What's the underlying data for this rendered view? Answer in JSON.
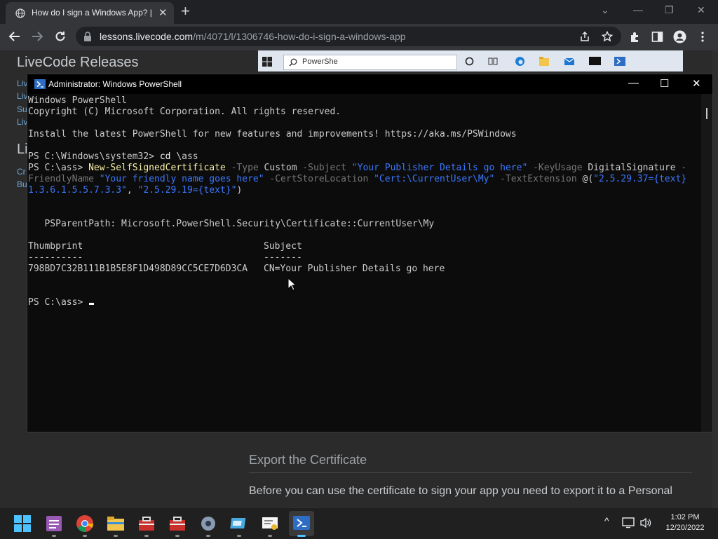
{
  "browser": {
    "tab": {
      "title": "How do I sign a Windows App? |",
      "close": "✕"
    },
    "new_tab": "+",
    "window_controls": {
      "menu": "⌄",
      "minimize": "—",
      "restore": "❐",
      "close": "✕"
    },
    "url_host": "lessons.livecode.com",
    "url_path": "/m/4071/l/1306746-how-do-i-sign-a-windows-app"
  },
  "page": {
    "heading_releases": "LiveCode Releases",
    "side_links": [
      "Liv",
      "Liv",
      "Su",
      "Liv"
    ],
    "side_heading_2": "Li",
    "side_links_2": [
      "Cr",
      "Bu"
    ],
    "video_search_text": "PowerShe",
    "export_heading": "Export the Certificate",
    "paragraph": "Before you can use the certificate to sign your app you need to export it to a Personal"
  },
  "powershell": {
    "title": "Administrator: Windows PowerShell",
    "lines": {
      "l1": "Windows PowerShell",
      "l2": "Copyright (C) Microsoft Corporation. All rights reserved.",
      "l3": "Install the latest PowerShell for new features and improvements! https://aka.ms/PSWindows",
      "l4_prompt": "PS C:\\Windows\\system32> ",
      "l4_cmd": "cd",
      "l4_arg": " \\ass",
      "l5_prompt": "PS C:\\ass> ",
      "l5_cmd": "New-SelfSignedCertificate",
      "p_type": " -Type",
      "v_type": " Custom",
      "p_subject": " -Subject",
      "v_subject": " \"Your Publisher Details go here\"",
      "p_keyusage": " -KeyUsage",
      "v_keyusage": " DigitalSignature",
      "p_dash": " -",
      "p_friendly": "FriendlyName",
      "v_friendly": " \"Your friendly name goes here\"",
      "p_store": " -CertStoreLocation",
      "v_store": " \"Cert:\\CurrentUser\\My\"",
      "p_textext": " -TextExtension",
      "v_at": " @(",
      "v_ext1": "\"2.5.29.37={text}",
      "v_ext1b": "1.3.6.1.5.5.7.3.3\"",
      "v_comma": ", ",
      "v_ext2": "\"2.5.29.19={text}\"",
      "v_close": ")",
      "parent_path": "   PSParentPath: Microsoft.PowerShell.Security\\Certificate::CurrentUser\\My",
      "hdr_thumb": "Thumbprint",
      "hdr_subject": "Subject",
      "dash_thumb": "----------",
      "dash_subject": "-------",
      "thumbprint": "798BD7C32B111B1B5E8F1D498D89CC5CE7D6D3CA",
      "subject": "CN=Your Publisher Details go here",
      "final_prompt": "PS C:\\ass> "
    },
    "controls": {
      "minimize": "—",
      "maximize": "☐",
      "close": "✕"
    }
  },
  "taskbar": {
    "clock_time": "1:02 PM",
    "clock_date": "12/20/2022",
    "tray_chevron": "^"
  },
  "colors": {
    "terminal_bg": "#0c0c0c",
    "terminal_text": "#cccccc",
    "cmdlet": "#f9f1a5",
    "param": "#767676",
    "string": "#3b78ff"
  }
}
